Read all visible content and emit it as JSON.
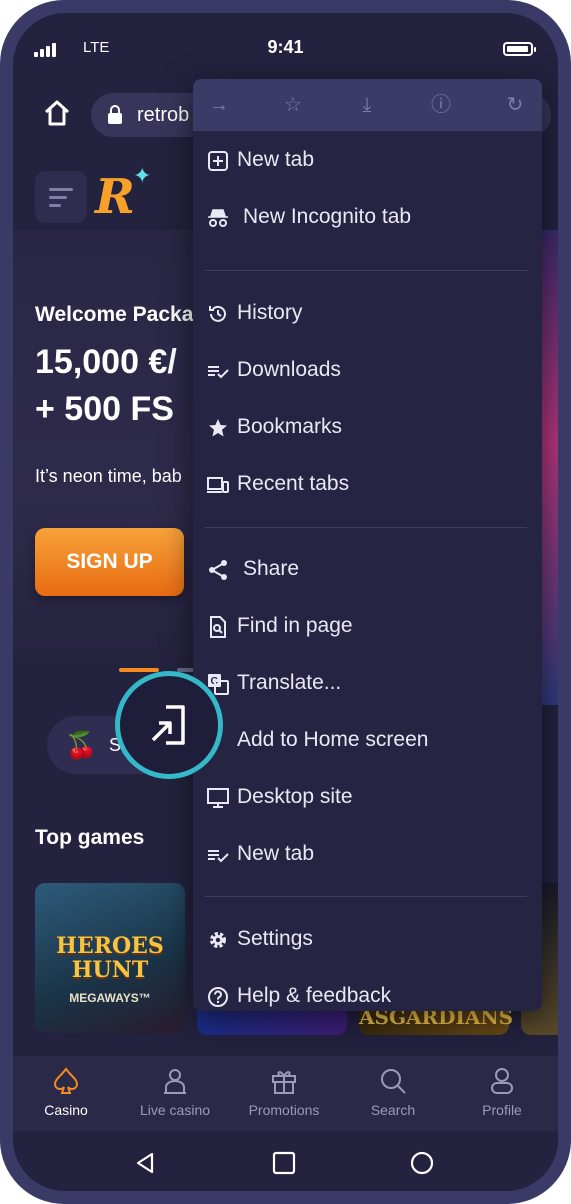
{
  "status_bar": {
    "network": "LTE",
    "time": "9:41"
  },
  "browser": {
    "url_text": "retrob",
    "menu": {
      "items": [
        {
          "label": "New tab",
          "icon": "plus-square-icon"
        },
        {
          "label": "New Incognito tab",
          "icon": "incognito-icon"
        },
        {
          "label": "History",
          "icon": "history-icon"
        },
        {
          "label": "Downloads",
          "icon": "downloads-icon"
        },
        {
          "label": "Bookmarks",
          "icon": "star-icon"
        },
        {
          "label": "Recent tabs",
          "icon": "devices-icon"
        },
        {
          "label": "Share",
          "icon": "share-icon"
        },
        {
          "label": "Find in page",
          "icon": "find-in-page-icon"
        },
        {
          "label": "Translate...",
          "icon": "translate-icon"
        },
        {
          "label": "Add to Home screen",
          "icon": "add-to-home-icon"
        },
        {
          "label": "Desktop site",
          "icon": "monitor-icon"
        },
        {
          "label": "New tab",
          "icon": "downloads-icon"
        },
        {
          "label": "Settings",
          "icon": "gear-icon"
        },
        {
          "label": "Help & feedback",
          "icon": "help-icon"
        }
      ]
    }
  },
  "site": {
    "welcome": "Welcome Packa",
    "headline_1": "15,000 €/",
    "headline_2": "+ 500 FS",
    "tagline": "It’s neon time, bab",
    "signup": "SIGN UP",
    "chip_label": "S",
    "top_games": "Top games",
    "games": [
      {
        "title_1": "HEROES",
        "title_2": "HUNT",
        "subtitle": "MEGAWAYS™"
      },
      {
        "title": "ASGARDIANS"
      }
    ]
  },
  "bottom_nav": [
    {
      "label": "Casino",
      "icon": "spade-icon",
      "active": true
    },
    {
      "label": "Live casino",
      "icon": "dealer-icon",
      "active": false
    },
    {
      "label": "Promotions",
      "icon": "gift-icon",
      "active": false
    },
    {
      "label": "Search",
      "icon": "search-icon",
      "active": false
    },
    {
      "label": "Profile",
      "icon": "user-icon",
      "active": false
    }
  ],
  "colors": {
    "accent": "#F58A1F",
    "highlight_ring": "#35B9C8",
    "background": "#23223F",
    "menu_bg": "#252443"
  }
}
